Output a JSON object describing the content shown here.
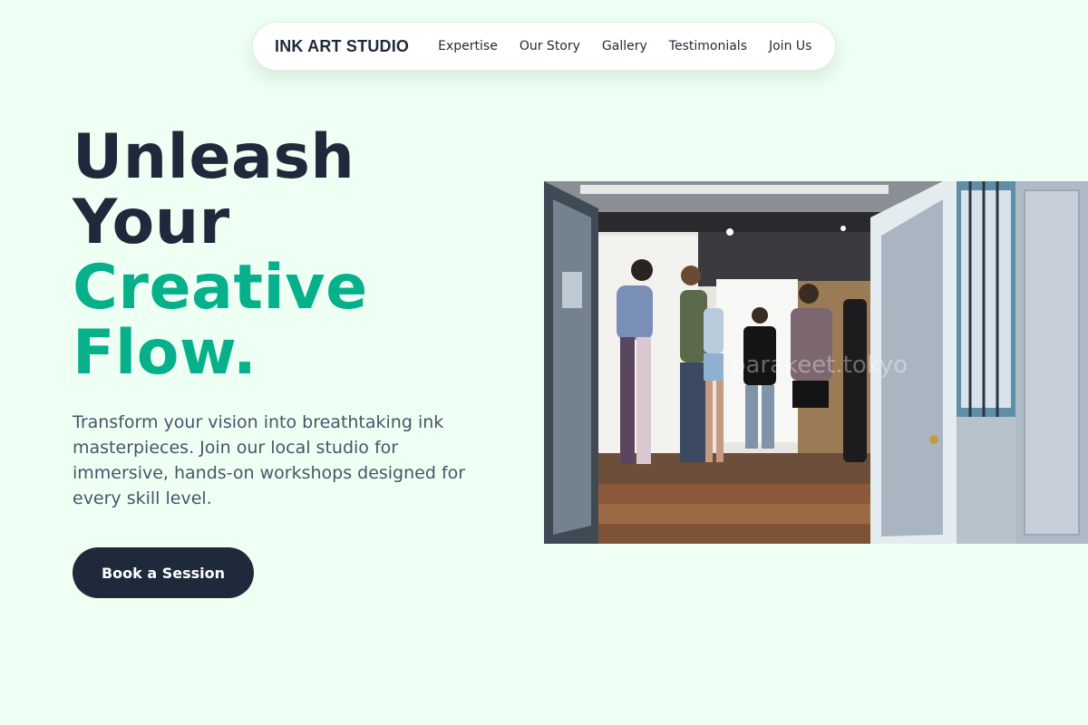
{
  "nav": {
    "brand": "INK ART STUDIO",
    "links": [
      "Expertise",
      "Our Story",
      "Gallery",
      "Testimonials",
      "Join Us"
    ]
  },
  "hero": {
    "title_line1": "Unleash",
    "title_line2": "Your",
    "title_accent_line1": "Creative",
    "title_accent_line2": "Flow.",
    "description": "Transform your vision into breathtaking ink masterpieces. Join our local studio for immersive, hands-on workshops designed for every skill level.",
    "cta_label": "Book a Session",
    "image_watermark": "parakeet.tokyo"
  },
  "colors": {
    "background": "#eefff3",
    "heading": "#1e293b",
    "accent": "#06b08b",
    "body_text": "#475569",
    "cta_background": "#1e293b"
  }
}
